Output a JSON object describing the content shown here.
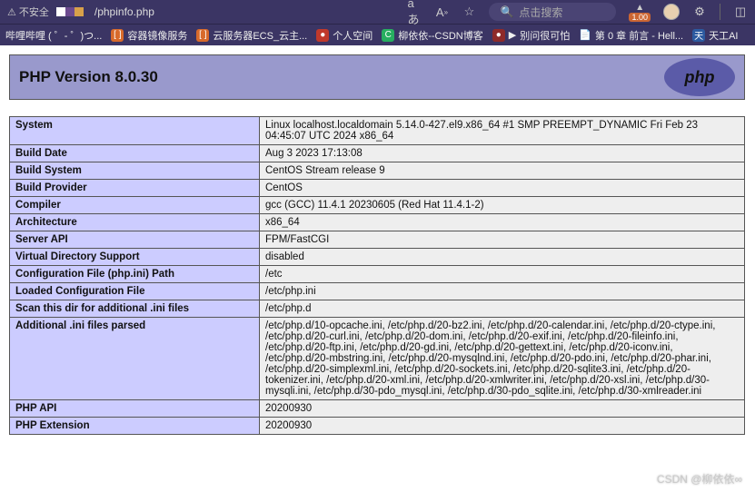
{
  "browser": {
    "security_label": "不安全",
    "url": "/phpinfo.php",
    "reader_label": "aあ",
    "search_placeholder": "点击搜索",
    "badge_value": "1.00"
  },
  "bookmarks": [
    {
      "label": "哔哩哔哩 ( ゜- ゜)つ...",
      "icon_class": ""
    },
    {
      "label": "容器镜像服务",
      "icon_class": "ic-orange"
    },
    {
      "label": "云服务器ECS_云主...",
      "icon_class": "ic-orange"
    },
    {
      "label": "个人空间",
      "icon_class": "ic-red"
    },
    {
      "label": "柳依依--CSDN博客",
      "icon_class": "ic-green"
    },
    {
      "label": "别问很可怕",
      "icon_class": "ic-dred",
      "prefix": "▶"
    },
    {
      "label": "第 0 章  前言 - Hell...",
      "icon_class": ""
    },
    {
      "label": "天工AI",
      "icon_class": "ic-blue"
    }
  ],
  "phpinfo": {
    "title": "PHP Version 8.0.30",
    "logo_text": "php",
    "rows": [
      {
        "k": "System",
        "v": "Linux localhost.localdomain 5.14.0-427.el9.x86_64 #1 SMP PREEMPT_DYNAMIC Fri Feb 23 04:45:07 UTC 2024 x86_64"
      },
      {
        "k": "Build Date",
        "v": "Aug 3 2023 17:13:08"
      },
      {
        "k": "Build System",
        "v": "CentOS Stream release 9"
      },
      {
        "k": "Build Provider",
        "v": "CentOS"
      },
      {
        "k": "Compiler",
        "v": "gcc (GCC) 11.4.1 20230605 (Red Hat 11.4.1-2)"
      },
      {
        "k": "Architecture",
        "v": "x86_64"
      },
      {
        "k": "Server API",
        "v": "FPM/FastCGI"
      },
      {
        "k": "Virtual Directory Support",
        "v": "disabled"
      },
      {
        "k": "Configuration File (php.ini) Path",
        "v": "/etc"
      },
      {
        "k": "Loaded Configuration File",
        "v": "/etc/php.ini"
      },
      {
        "k": "Scan this dir for additional .ini files",
        "v": "/etc/php.d"
      },
      {
        "k": "Additional .ini files parsed",
        "v": "/etc/php.d/10-opcache.ini, /etc/php.d/20-bz2.ini, /etc/php.d/20-calendar.ini, /etc/php.d/20-ctype.ini, /etc/php.d/20-curl.ini, /etc/php.d/20-dom.ini, /etc/php.d/20-exif.ini, /etc/php.d/20-fileinfo.ini, /etc/php.d/20-ftp.ini, /etc/php.d/20-gd.ini, /etc/php.d/20-gettext.ini, /etc/php.d/20-iconv.ini, /etc/php.d/20-mbstring.ini, /etc/php.d/20-mysqlnd.ini, /etc/php.d/20-pdo.ini, /etc/php.d/20-phar.ini, /etc/php.d/20-simplexml.ini, /etc/php.d/20-sockets.ini, /etc/php.d/20-sqlite3.ini, /etc/php.d/20-tokenizer.ini, /etc/php.d/20-xml.ini, /etc/php.d/20-xmlwriter.ini, /etc/php.d/20-xsl.ini, /etc/php.d/30-mysqli.ini, /etc/php.d/30-pdo_mysql.ini, /etc/php.d/30-pdo_sqlite.ini, /etc/php.d/30-xmlreader.ini"
      },
      {
        "k": "PHP API",
        "v": "20200930"
      },
      {
        "k": "PHP Extension",
        "v": "20200930"
      }
    ]
  },
  "watermark": "CSDN @柳依依∞"
}
